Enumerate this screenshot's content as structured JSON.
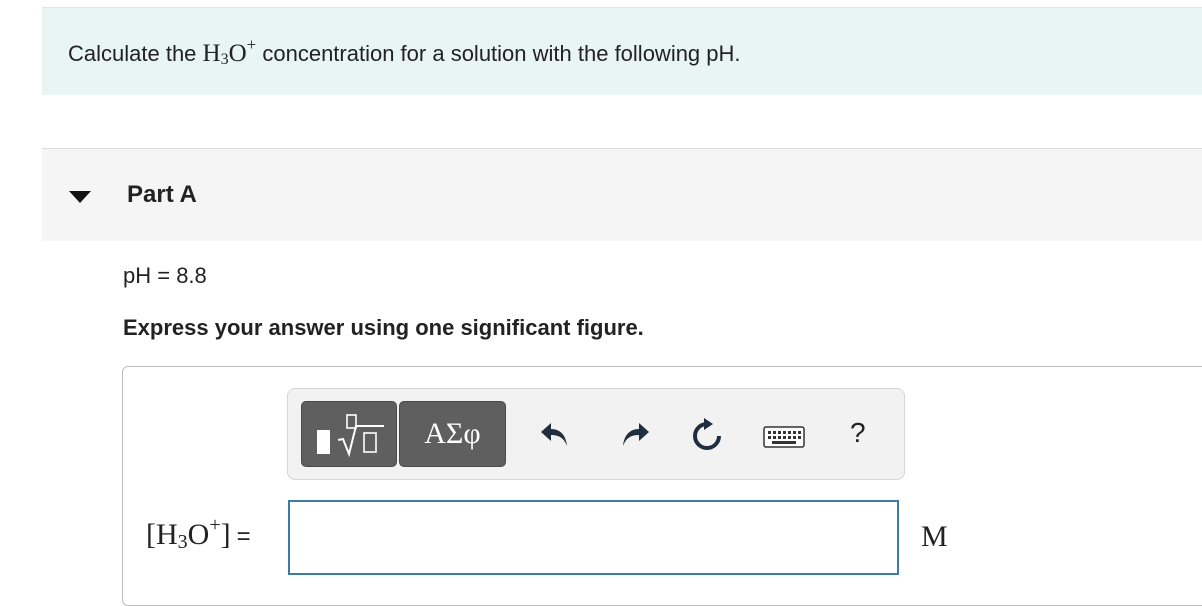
{
  "intro": {
    "text_before": "Calculate the ",
    "chem_H": "H",
    "chem_sub": "3",
    "chem_O": "O",
    "chem_sup": "+",
    "text_after": " concentration for a solution with the following pH."
  },
  "part": {
    "title": "Part A"
  },
  "question": {
    "ph_line": "pH = 8.8",
    "instruction": "Express your answer using one significant figure."
  },
  "toolbar": {
    "greek_label": "ΑΣφ",
    "help_label": "?",
    "icons": [
      "templates-icon",
      "undo-icon",
      "redo-icon",
      "reset-icon",
      "keyboard-icon",
      "help-icon"
    ]
  },
  "answer": {
    "lhs_open": "[",
    "lhs_H": "H",
    "lhs_sub": "3",
    "lhs_O": "O",
    "lhs_sup": "+",
    "lhs_close": "]",
    "equals": "=",
    "value": "",
    "unit": "M"
  },
  "colors": {
    "intro_bg": "#e9f5f5",
    "part_bg": "#f5f5f5",
    "input_border": "#3a7ca3",
    "toolbar_button": "#5f5f5f"
  }
}
